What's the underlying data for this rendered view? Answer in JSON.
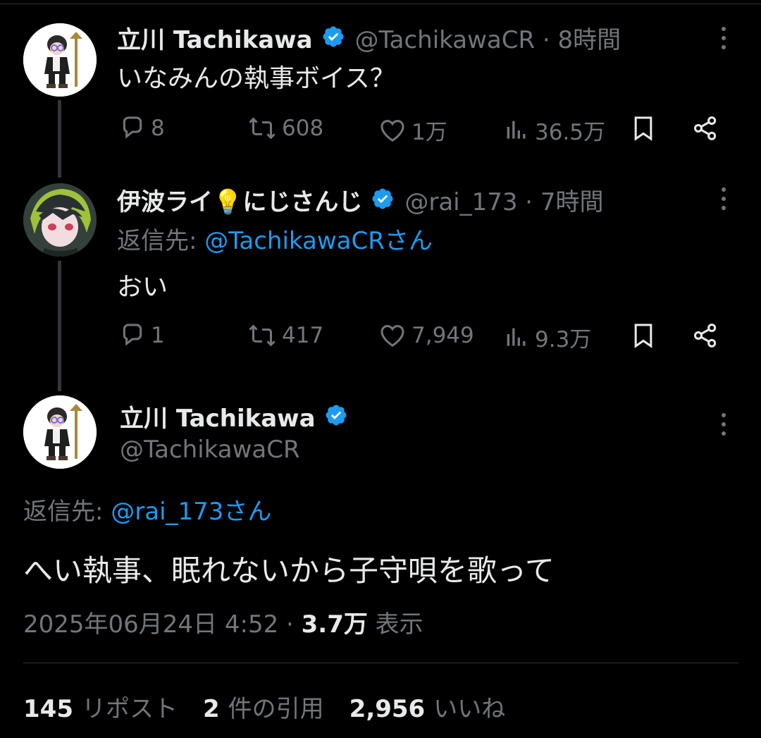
{
  "colors": {
    "background": "#000000",
    "text_primary": "#e7e9ea",
    "text_secondary": "#71767b",
    "link": "#1d9bf0",
    "verified": "#1d9bf0",
    "divider": "#2f3336"
  },
  "tweet1": {
    "author_name": "立川 Tachikawa",
    "handle_time": "@TachikawaCR · 8時間",
    "text": "いなみんの執事ボイス？",
    "stats": {
      "replies": "8",
      "reposts": "608",
      "likes": "1万",
      "views": "36.5万"
    }
  },
  "tweet2": {
    "author_name": "伊波ライ💡にじさんじ",
    "handle_time": "@rai_173 · 7時間",
    "reply_label": "返信先: ",
    "reply_handle": "@TachikawaCRさん",
    "text": "おい",
    "stats": {
      "replies": "1",
      "reposts": "417",
      "likes": "7,949",
      "views": "9.3万"
    }
  },
  "main": {
    "author_name": "立川 Tachikawa",
    "handle": "@TachikawaCR",
    "reply_label": "返信先: ",
    "reply_handle": "@rai_173さん",
    "text": "へい執事、眠れないから子守唄を歌って",
    "timestamp": "2025年06月24日 4:52 · ",
    "views_count": "3.7万",
    "views_label": " 表示",
    "reposts_count": "145",
    "reposts_label": "リポスト",
    "quotes_count": "2",
    "quotes_label": "件の引用",
    "likes_count": "2,956",
    "likes_label": "いいね"
  },
  "icons": [
    "verified-badge-icon",
    "more-icon",
    "reply-icon",
    "repost-icon",
    "like-icon",
    "views-icon",
    "bookmark-icon",
    "share-icon"
  ]
}
